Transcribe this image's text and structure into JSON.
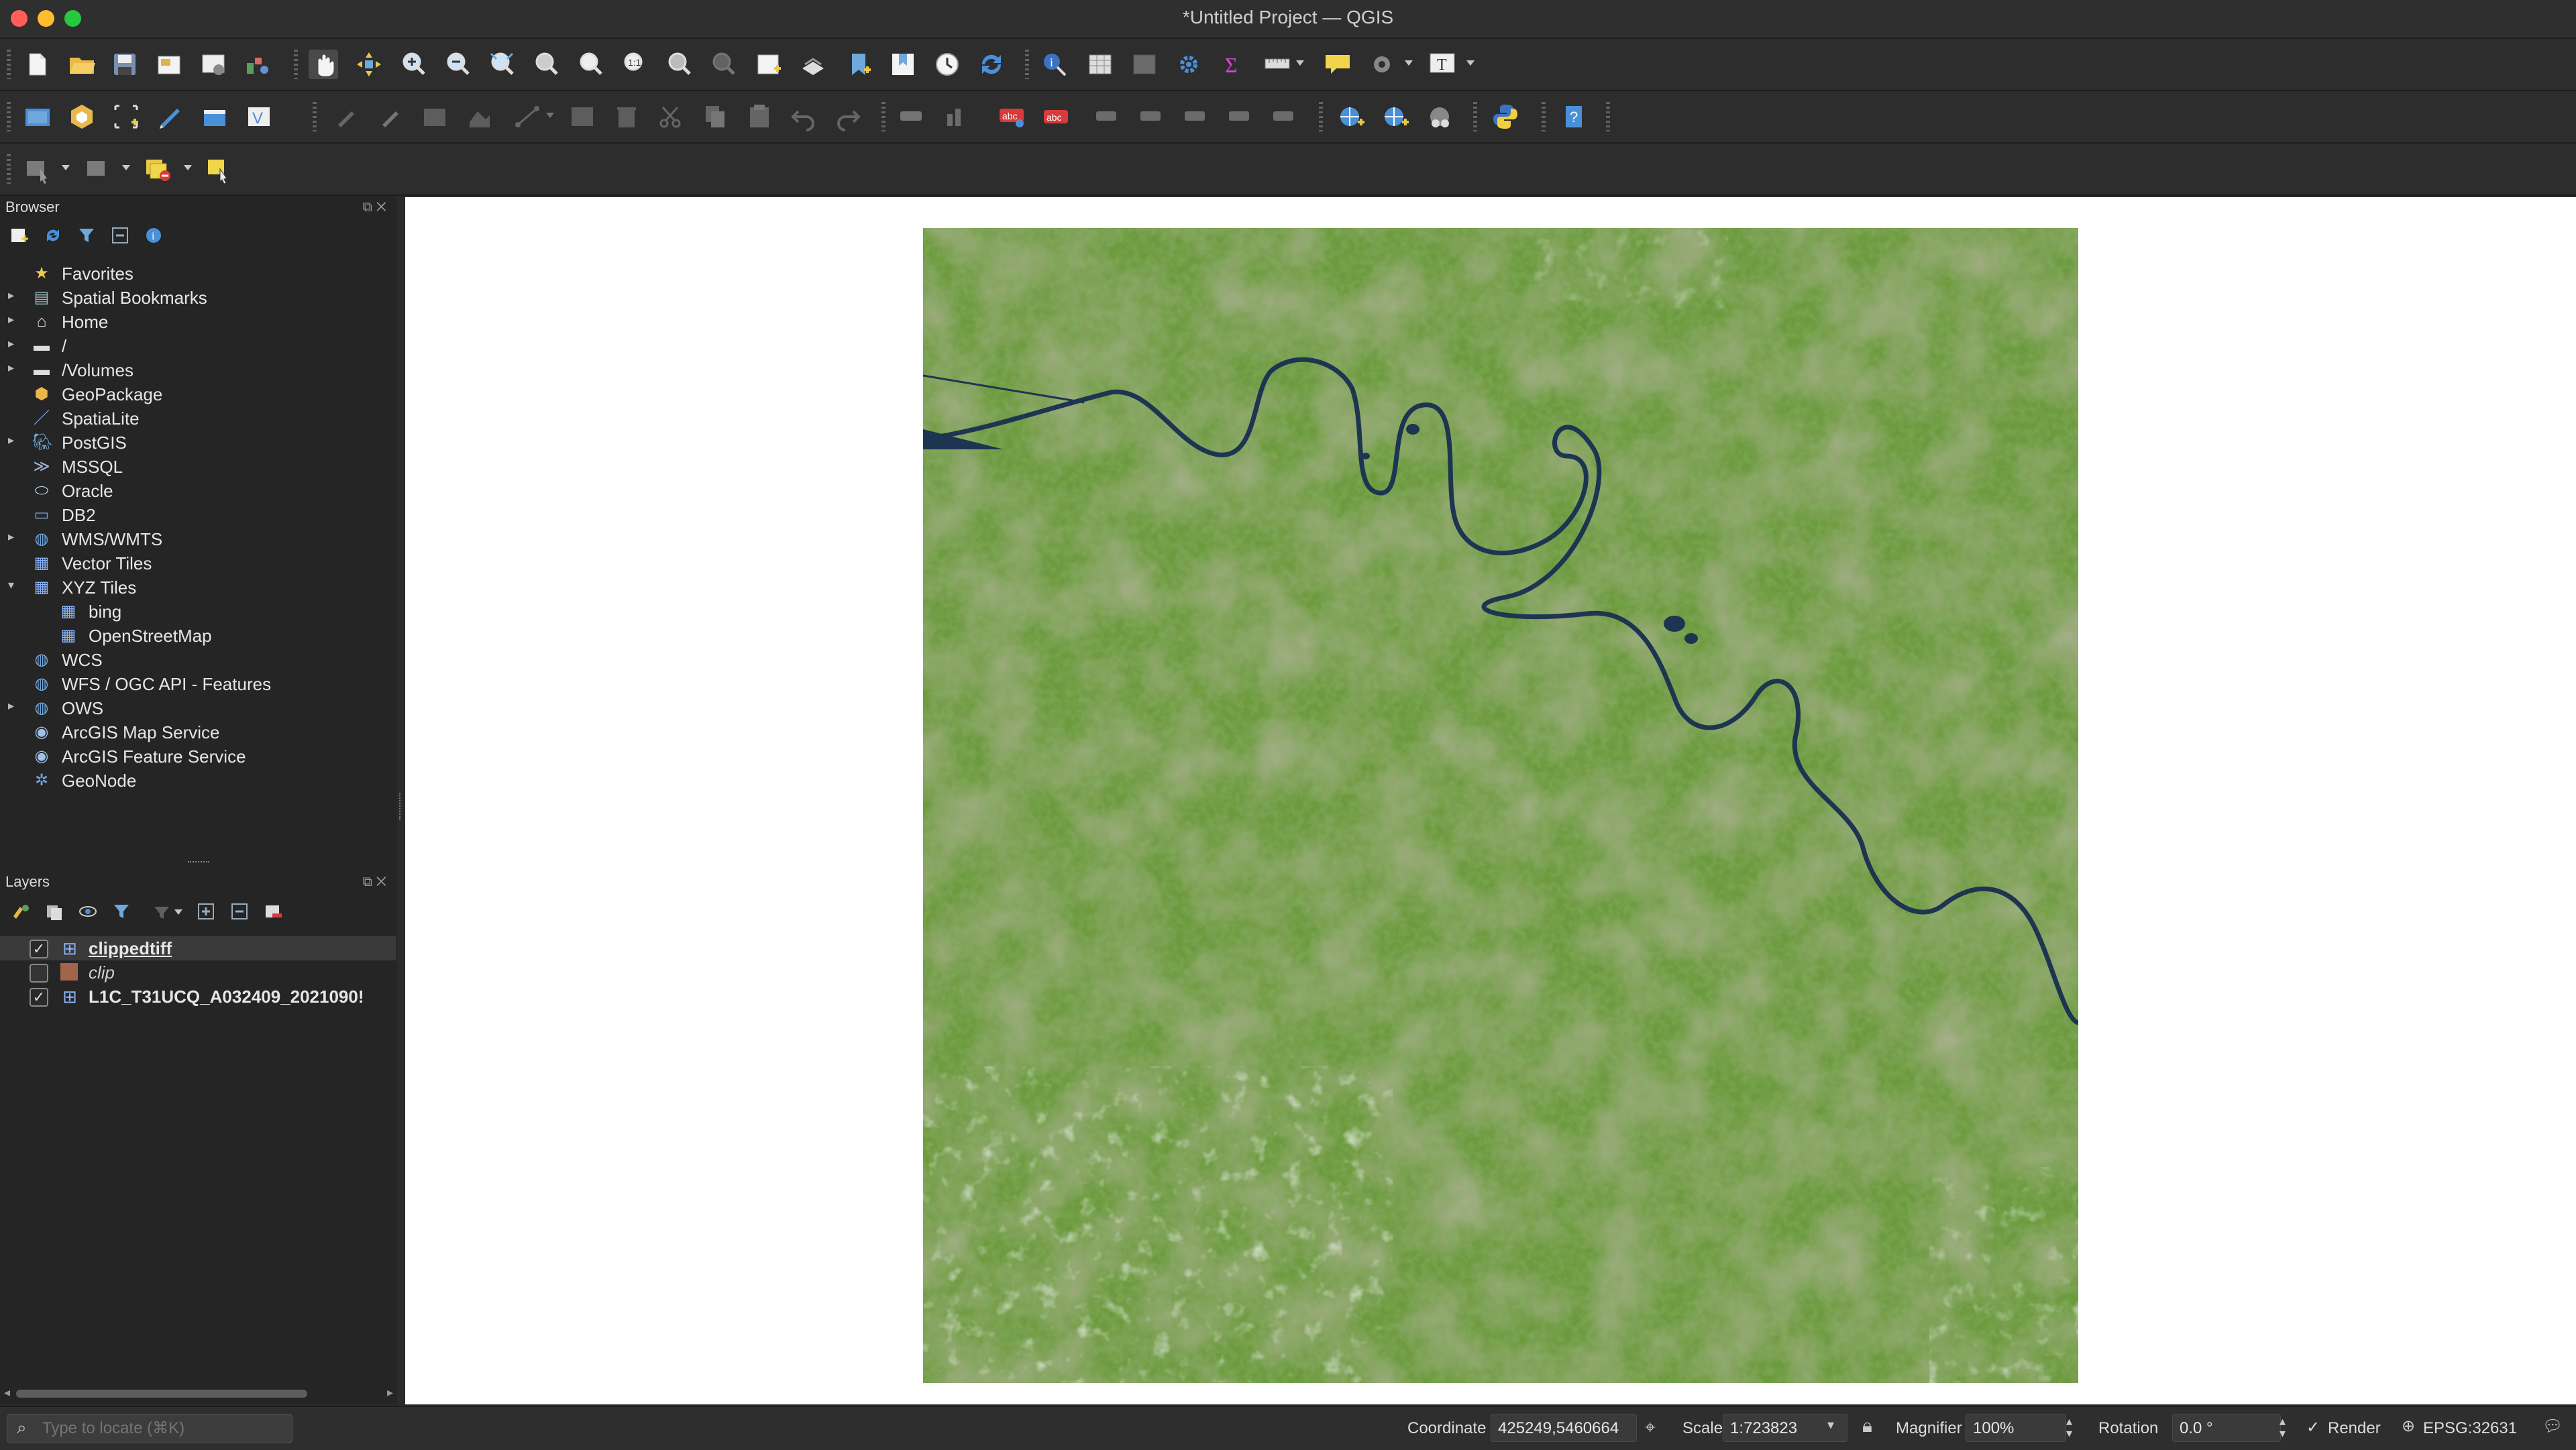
{
  "window": {
    "title": "*Untitled Project — QGIS"
  },
  "browser_panel": {
    "title": "Browser",
    "items": [
      {
        "label": "Favorites",
        "icon": "star-icon",
        "expandable": false
      },
      {
        "label": "Spatial Bookmarks",
        "icon": "bookmark-icon",
        "expandable": true
      },
      {
        "label": "Home",
        "icon": "home-folder-icon",
        "expandable": true
      },
      {
        "label": "/",
        "icon": "folder-icon",
        "expandable": true
      },
      {
        "label": "/Volumes",
        "icon": "folder-icon",
        "expandable": true
      },
      {
        "label": "GeoPackage",
        "icon": "geopackage-icon",
        "expandable": false
      },
      {
        "label": "SpatiaLite",
        "icon": "spatialite-icon",
        "expandable": false
      },
      {
        "label": "PostGIS",
        "icon": "postgis-icon",
        "expandable": true
      },
      {
        "label": "MSSQL",
        "icon": "mssql-icon",
        "expandable": false
      },
      {
        "label": "Oracle",
        "icon": "oracle-icon",
        "expandable": false
      },
      {
        "label": "DB2",
        "icon": "db2-icon",
        "expandable": false
      },
      {
        "label": "WMS/WMTS",
        "icon": "globe-icon",
        "expandable": true
      },
      {
        "label": "Vector Tiles",
        "icon": "grid-icon",
        "expandable": false
      },
      {
        "label": "XYZ Tiles",
        "icon": "grid-icon",
        "expandable": true,
        "expanded": true
      },
      {
        "label": "bing",
        "icon": "grid-icon",
        "child": true
      },
      {
        "label": "OpenStreetMap",
        "icon": "grid-icon",
        "child": true
      },
      {
        "label": "WCS",
        "icon": "globe-icon",
        "expandable": false
      },
      {
        "label": "WFS / OGC API - Features",
        "icon": "globe-icon",
        "expandable": false
      },
      {
        "label": "OWS",
        "icon": "globe-icon",
        "expandable": true
      },
      {
        "label": "ArcGIS Map Service",
        "icon": "arcgis-icon",
        "expandable": false
      },
      {
        "label": "ArcGIS Feature Service",
        "icon": "arcgis-icon",
        "expandable": false
      },
      {
        "label": "GeoNode",
        "icon": "geonode-icon",
        "expandable": false
      }
    ]
  },
  "layers_panel": {
    "title": "Layers",
    "layers": [
      {
        "label": "clippedtiff",
        "checked": true,
        "selected": true,
        "icon": "raster-icon",
        "style": "bold-underline"
      },
      {
        "label": "clip",
        "checked": false,
        "selected": false,
        "icon": "polygon-fill-icon",
        "style": "italic"
      },
      {
        "label": "L1C_T31UCQ_A032409_2021090!",
        "checked": true,
        "selected": false,
        "icon": "raster-icon",
        "style": "bold"
      }
    ]
  },
  "status_bar": {
    "locate_placeholder": "Type to locate (⌘K)",
    "coordinate_label": "Coordinate",
    "coordinate_value": "425249,5460664",
    "scale_label": "Scale",
    "scale_value": "1:723823",
    "magnifier_label": "Magnifier",
    "magnifier_value": "100%",
    "rotation_label": "Rotation",
    "rotation_value": "0.0 °",
    "render_label": "Render",
    "render_checked": true,
    "crs_label": "EPSG:32631"
  },
  "colors": {
    "accent_selection": "#3a3a3a",
    "map_vegetation": "#6d9a3e",
    "river": "#1d3550"
  }
}
